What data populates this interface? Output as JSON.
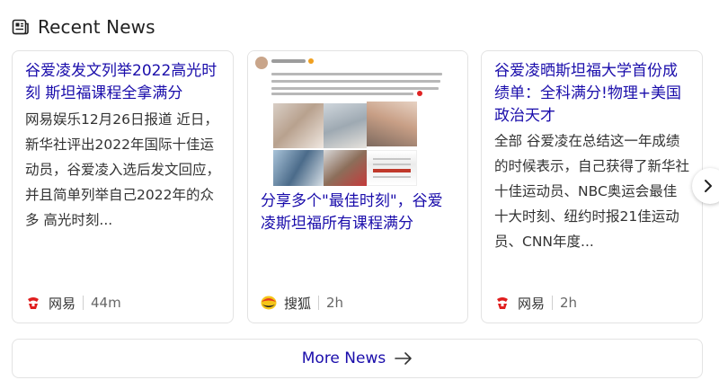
{
  "section": {
    "title": "Recent News",
    "icon": "news-icon"
  },
  "cards": [
    {
      "headline": "谷爱凌发文列举2022高光时刻 斯坦福课程全拿满分",
      "snippet": "网易娱乐12月26日报道 近日，新华社评出2022年国际十佳运动员，谷爱凌入选后发文回应，并且简单列举自己2022年的众多 高光时刻...",
      "source": "网易",
      "source_icon": "netease-logo-icon",
      "time": "44m"
    },
    {
      "headline": "分享多个\"最佳时刻\"，谷爱凌斯坦福所有课程满分",
      "source": "搜狐",
      "source_icon": "sohu-logo-icon",
      "time": "2h",
      "thumbnail": "social-post-screenshot"
    },
    {
      "headline": "谷爱凌晒斯坦福大学首份成绩单：全科满分!物理+美国政治天才",
      "snippet": "全部 谷爱凌在总结这一年成绩的时候表示，自己获得了新华社十佳运动员、NBC奥运会最佳十大时刻、纽约时报21佳运动员、CNN年度...",
      "source": "网易",
      "source_icon": "netease-logo-icon",
      "time": "2h"
    }
  ],
  "carousel": {
    "next_icon": "chevron-right-icon"
  },
  "more_news": {
    "label": "More News",
    "icon": "arrow-right-icon"
  },
  "colors": {
    "headline": "#1a0dab",
    "text": "#333333",
    "border": "#e3e3e3",
    "netease_red": "#e01e1e",
    "sohu_yellow": "#f5c518"
  }
}
